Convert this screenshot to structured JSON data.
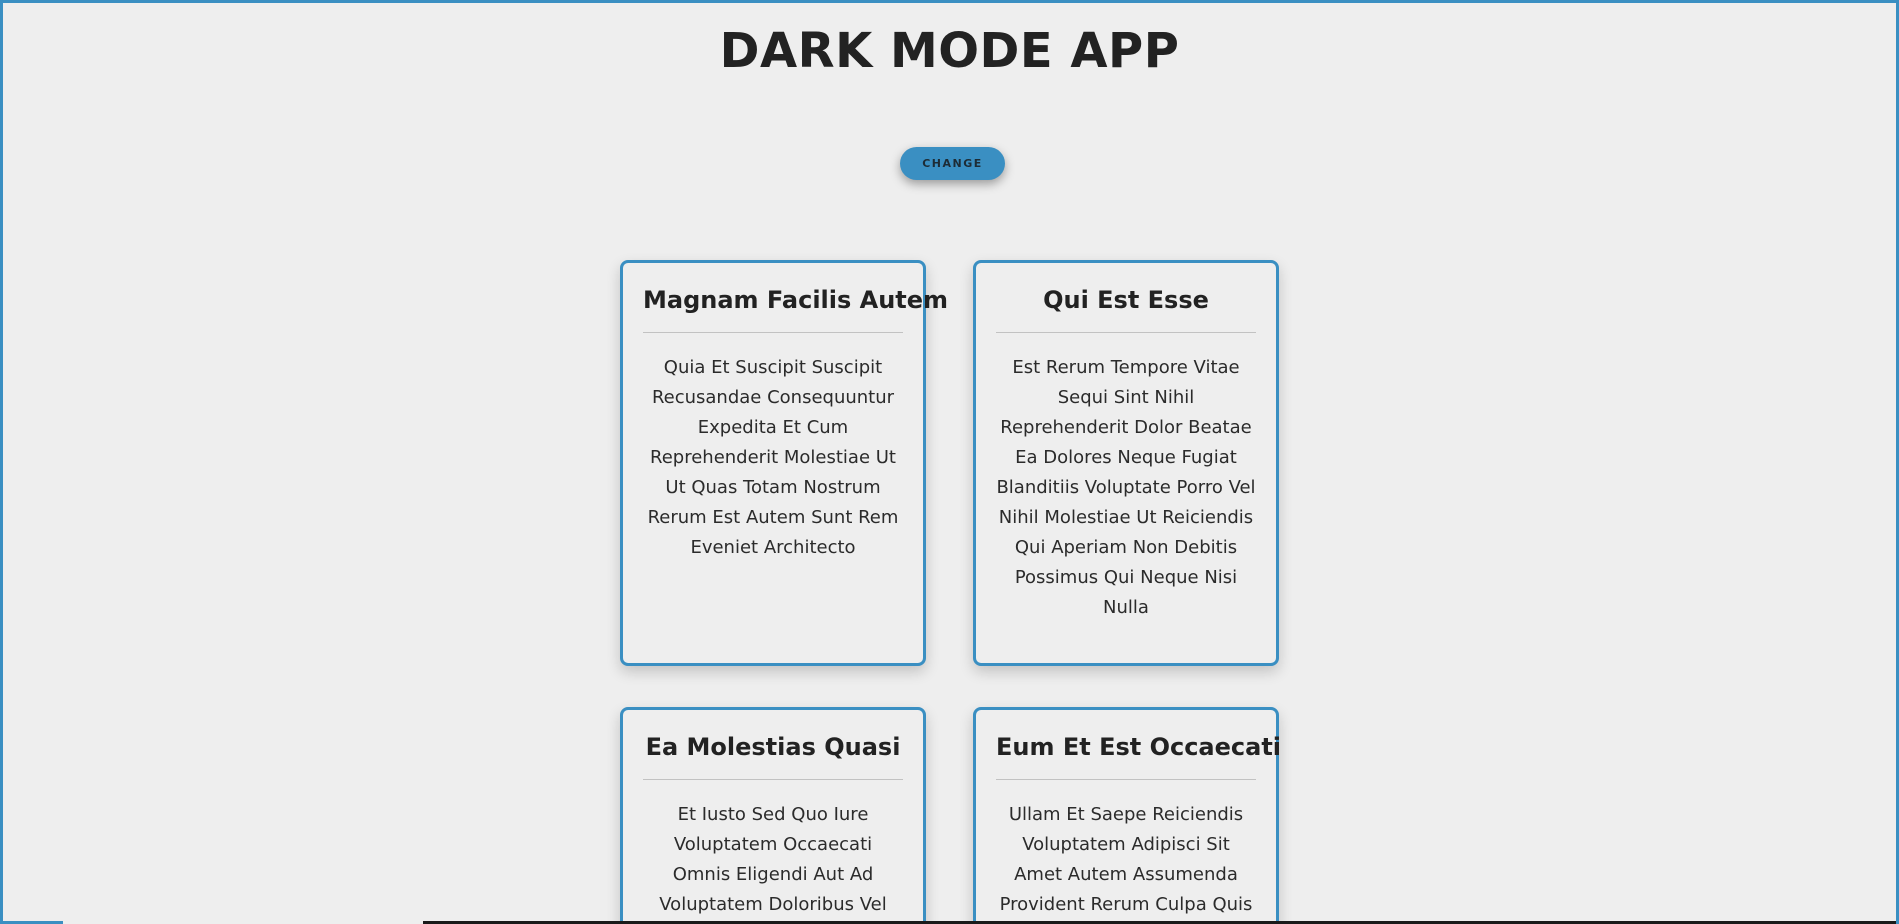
{
  "app": {
    "title": "DARK MODE APP"
  },
  "toolbar": {
    "change_label": "CHANGE"
  },
  "cards": [
    {
      "title": "Magnam Facilis Autem",
      "body": "Quia Et Suscipit Suscipit Recusandae Consequuntur Expedita Et Cum Reprehenderit Molestiae Ut Ut Quas Totam Nostrum Rerum Est Autem Sunt Rem Eveniet Architecto"
    },
    {
      "title": "Qui Est Esse",
      "body": "Est Rerum Tempore Vitae Sequi Sint Nihil Reprehenderit Dolor Beatae Ea Dolores Neque Fugiat Blanditiis Voluptate Porro Vel Nihil Molestiae Ut Reiciendis Qui Aperiam Non Debitis Possimus Qui Neque Nisi Nulla"
    },
    {
      "title": "Ea Molestias Quasi",
      "body": "Et Iusto Sed Quo Iure Voluptatem Occaecati Omnis Eligendi Aut Ad Voluptatem Doloribus Vel Accusantium"
    },
    {
      "title": "Eum Et Est Occaecati",
      "body": "Ullam Et Saepe Reiciendis Voluptatem Adipisci Sit Amet Autem Assumenda Provident Rerum Culpa Quis Hic"
    }
  ],
  "colors": {
    "accent": "#3a8fc2",
    "background": "#eeeeee",
    "text": "#222222"
  }
}
